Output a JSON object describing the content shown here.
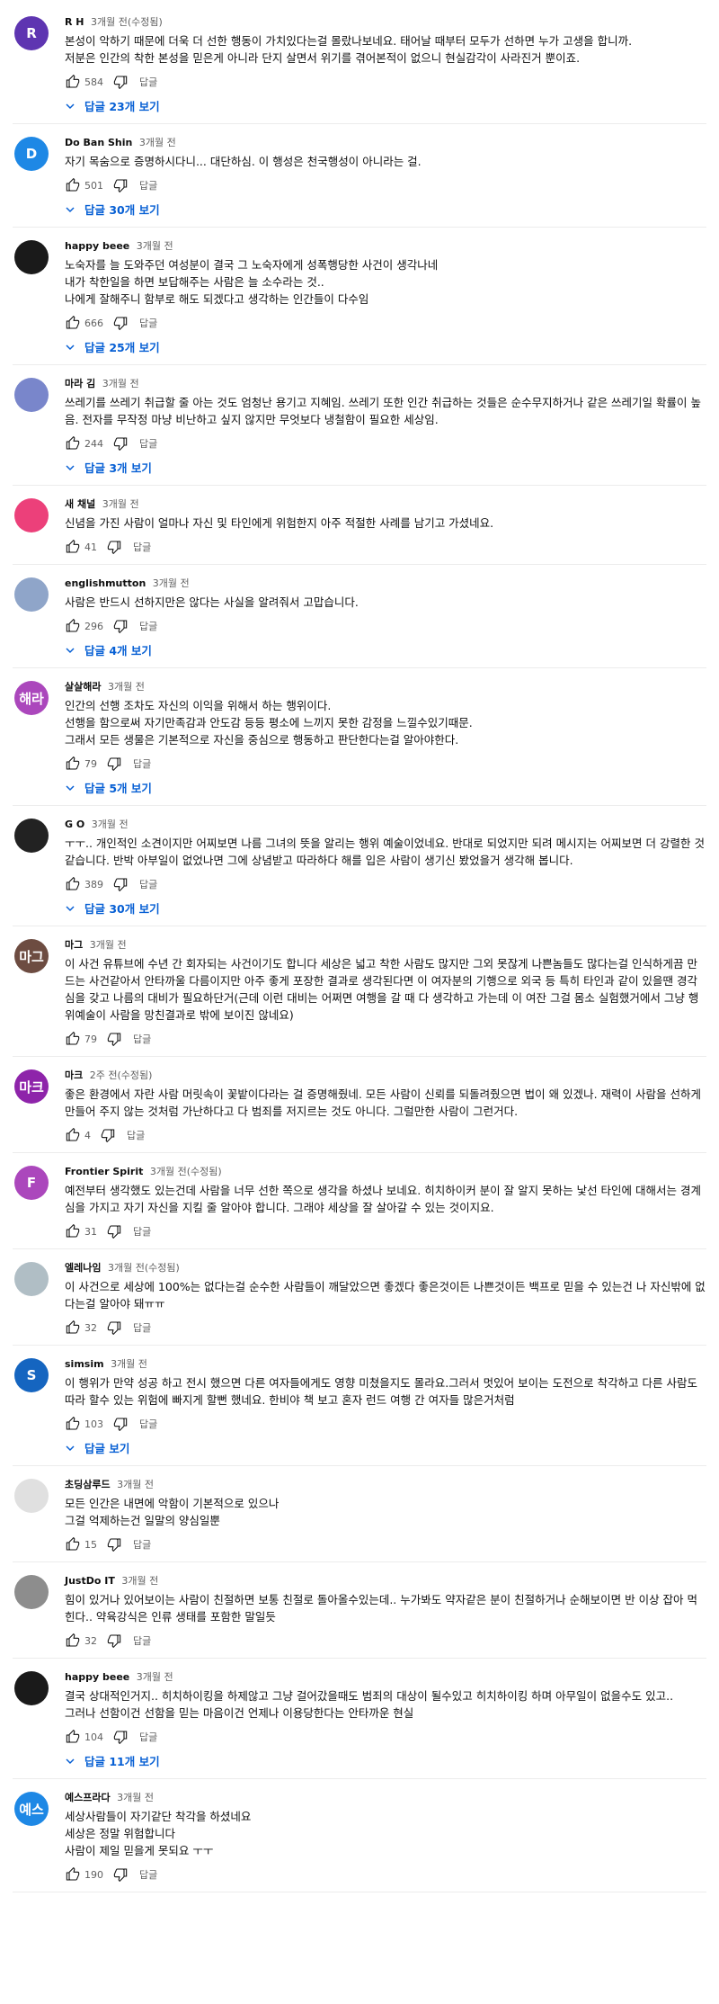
{
  "colors": {
    "accent": "#065fd4",
    "meta": "#606060"
  },
  "comments": [
    {
      "avatar": {
        "letter": "R",
        "color": "#5e35b1"
      },
      "author": "R H",
      "time": "3개월 전(수정됨)",
      "text": "본성이 악하기 때문에 더욱 더 선한 행동이 가치있다는걸 몰랐나보네요. 태어날 때부터 모두가 선하면 누가 고생을 합니까.\n저분은 인간의 착한 본성을 믿은게 아니라 단지 살면서 위기를 겪어본적이 없으니 현실감각이 사라진거 뿐이죠.",
      "likes": "584",
      "reply_label": "답글",
      "replies": "답글 23개 보기"
    },
    {
      "avatar": {
        "letter": "D",
        "color": "#1e88e5"
      },
      "author": "Do Ban Shin",
      "time": "3개월 전",
      "text": "자기 목숨으로 증명하시다니... 대단하심. 이 행성은 천국행성이 아니라는 걸.",
      "likes": "501",
      "reply_label": "답글",
      "replies": "답글 30개 보기"
    },
    {
      "avatar": {
        "letter": "",
        "color": "#1a1a1a"
      },
      "author": "happy beee",
      "time": "3개월 전",
      "text": "노숙자를 늘 도와주던 여성분이 결국 그 노숙자에게 성폭행당한 사건이 생각나네\n내가 착한일을 하면 보답해주는 사람은 늘 소수라는 것..\n나에게 잘해주니 함부로 해도 되겠다고 생각하는 인간들이 다수임",
      "likes": "666",
      "reply_label": "답글",
      "replies": "답글 25개 보기"
    },
    {
      "avatar": {
        "letter": "",
        "color": "#7986cb"
      },
      "author": "마라 김",
      "time": "3개월 전",
      "text": "쓰레기를 쓰레기 취급할 줄 아는 것도 엄청난 용기고 지혜임. 쓰레기 또한 인간 취급하는 것들은 순수무지하거나 같은 쓰레기일 확률이 높음. 전자를 무작정 마냥 비난하고 싶지 않지만  무엇보다 냉철함이 필요한 세상임.",
      "likes": "244",
      "reply_label": "답글",
      "replies": "답글 3개 보기"
    },
    {
      "avatar": {
        "letter": "",
        "color": "#ec407a"
      },
      "author": "새 채널",
      "time": "3개월 전",
      "text": "신념을 가진 사람이 얼마나 자신 및 타인에게 위험한지 아주 적절한 사례를 남기고 가셨네요.",
      "likes": "41",
      "reply_label": "답글",
      "replies": ""
    },
    {
      "avatar": {
        "letter": "",
        "color": "#8fa5c9"
      },
      "author": "englishmutton",
      "time": "3개월 전",
      "text": "사람은 반드시 선하지만은 않다는 사실을 알려줘서 고맙습니다.",
      "likes": "296",
      "reply_label": "답글",
      "replies": "답글 4개 보기"
    },
    {
      "avatar": {
        "letter": "해라",
        "color": "#ab47bc"
      },
      "author": "살살해라",
      "time": "3개월 전",
      "text": "인간의 선행 조차도 자신의 이익을 위해서 하는 행위이다.\n선행을 함으로써 자기만족감과 안도감 등등 평소에 느끼지 못한 감정을 느낄수있기때문.\n그래서 모든 생물은 기본적으로 자신을 중심으로 행동하고 판단한다는걸 알아야한다.",
      "likes": "79",
      "reply_label": "답글",
      "replies": "답글 5개 보기"
    },
    {
      "avatar": {
        "letter": "",
        "color": "#222222"
      },
      "author": "G O",
      "time": "3개월 전",
      "text": "ㅜㅜ.. 개인적인 소견이지만 어찌보면 나름 그녀의 뜻을 알리는 행위 예술이었네요. 반대로 되었지만 되려 메시지는 어찌보면 더 강렬한 것 같습니다. 반박 아부일이 없었나면 그에 상념받고 따라하다 해를 입은 사람이 생기신 봤었을거 생각해 봅니다.",
      "likes": "389",
      "reply_label": "답글",
      "replies": "답글 30개 보기"
    },
    {
      "avatar": {
        "letter": "마그",
        "color": "#6d4c41"
      },
      "author": "마그",
      "time": "3개월 전",
      "text": "이 사건 유튜브에 수년 간 회자되는 사건이기도 합니다 세상은 넓고 착한 사람도 많지만 그외 못잖게 나쁜놈들도 많다는걸 인식하게끔 만드는 사건같아서 안타까울 다름이지만 아주 좋게 포장한 결과로 생각된다면 이 여자분의 기행으로 외국 등 특히 타인과 같이 있을땐 경각심을 갖고 나름의 대비가 필요하단거(근데 이런 대비는 어쩌면 여행을 갈 때 다 생각하고 가는데 이 여잔 그걸 몸소 실험했거에서 그냥 행위예술이 사람을 망친결과로 밖에 보이진 않네요)",
      "likes": "79",
      "reply_label": "답글",
      "replies": ""
    },
    {
      "avatar": {
        "letter": "마크",
        "color": "#8e24aa"
      },
      "author": "마크",
      "time": "2주 전(수정됨)",
      "text": "좋은 환경에서 자란 사람 머릿속이 꽃밭이다라는 걸 증명해줬네. 모든 사람이 신뢰를 되돌려줬으면 법이 왜 있겠나. 재력이 사람을 선하게 만들어 주지 않는 것처럼 가난하다고 다 범죄를 저지르는 것도 아니다. 그럴만한 사람이 그런거다.",
      "likes": "4",
      "reply_label": "답글",
      "replies": ""
    },
    {
      "avatar": {
        "letter": "F",
        "color": "#ab47bc"
      },
      "author": "Frontier Spirit",
      "time": "3개월 전(수정됨)",
      "text": "예전부터 생각했도 있는건데  사람을 너무 선한 쪽으로 생각을 하셨나 보네요. 히치하이커 분이  잘 알지 못하는 낯선 타인에 대해서는 경계심을 가지고 자기 자신을 지킬 줄 알아야 합니다. 그래야 세상을 잘 살아갈 수 있는 것이지요.",
      "likes": "31",
      "reply_label": "답글",
      "replies": ""
    },
    {
      "avatar": {
        "letter": "",
        "color": "#b0bec5"
      },
      "author": "엘레나임",
      "time": "3개월 전(수정됨)",
      "text": "이 사건으로 세상에 100%는 없다는걸 순수한 사람들이 깨달았으면 좋겠다 좋은것이든 나쁜것이든  백프로 믿을 수 있는건 나 자신밖에 없다는걸 알아야 돼ㅠㅠ",
      "likes": "32",
      "reply_label": "답글",
      "replies": ""
    },
    {
      "avatar": {
        "letter": "S",
        "color": "#1565c0"
      },
      "author": "simsim",
      "time": "3개월 전",
      "text": "이 행위가 만약 성공 하고 전시 했으면 다른 여자들에게도 영향 미쳤을지도 몰라요.그러서 멋있어 보이는 도전으로 착각하고 다른 사람도 따라 할수 있는 위험에 빠지게 할뻔 했네요. 한비야 책 보고 혼자 런드 여행 간 여자들 많은거처럼",
      "likes": "103",
      "reply_label": "답글",
      "replies": "답글 보기"
    },
    {
      "avatar": {
        "letter": "",
        "color": "#e0e0e0"
      },
      "author": "초딩삼루드",
      "time": "3개월 전",
      "text": "모든 인간은 내면에 악함이 기본적으로 있으나\n그걸 억제하는건 일말의 양심일뿐",
      "likes": "15",
      "reply_label": "답글",
      "replies": ""
    },
    {
      "avatar": {
        "letter": "",
        "color": "#8d8d8d"
      },
      "author": "JustDo IT",
      "time": "3개월 전",
      "text": "힘이 있거나 있어보이는 사람이 친절하면 보통 친절로 돌아올수있는데.. 누가봐도 약자같은 분이 친절하거나 순해보이면 반 이상 잡아 먹힌다.. 약육강식은 인류 생태를 포함한 말일듯",
      "likes": "32",
      "reply_label": "답글",
      "replies": ""
    },
    {
      "avatar": {
        "letter": "",
        "color": "#1a1a1a"
      },
      "author": "happy beee",
      "time": "3개월 전",
      "text": "결국 상대적인거지.. 히치하이킹을 하제않고 그냥 걸어갔을때도 범죄의 대상이 될수있고 히치하이킹 하며 아무일이 없을수도 있고..\n그러나 선함이건 선함을 믿는 마음이건 언제나 이용당한다는 안타까운 현실",
      "likes": "104",
      "reply_label": "답글",
      "replies": "답글 11개 보기"
    },
    {
      "avatar": {
        "letter": "예스",
        "color": "#1e88e5"
      },
      "author": "예스프라다",
      "time": "3개월 전",
      "text": "세상사람들이 자기같단 착각을 하셨네요\n세상은 정말 위험합니다\n사람이 제일 믿을게 못되요 ㅜㅜ",
      "likes": "190",
      "reply_label": "답글",
      "replies": ""
    }
  ]
}
